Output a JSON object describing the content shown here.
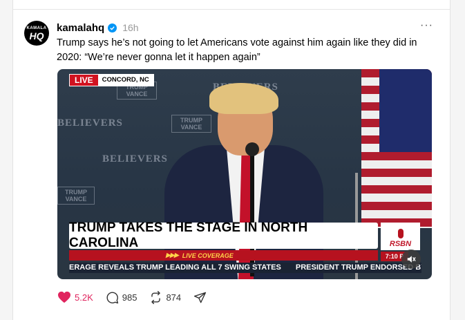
{
  "post": {
    "username": "kamalahq",
    "timestamp": "16h",
    "avatar_text_top": "KAMALA",
    "avatar_text_main": "HQ",
    "more_label": "···",
    "caption": "Trump says he’s not going to let Americans vote against him again like they did in 2020: “We’re never gonna let it happen again”"
  },
  "video": {
    "live_label": "LIVE",
    "location": "CONCORD, NC",
    "backdrop": {
      "believers_1": "BELIEVERS",
      "believers_2": "BELIEVERS",
      "believers_3": "BELIEVERS",
      "trump_vance_1": "TRUMP VANCE",
      "trump_vance_2": "TRUMP VANCE",
      "trump_vance_3": "TRUMP VANCE"
    },
    "chyron": "TRUMP TAKES THE STAGE IN NORTH CAROLINA",
    "live_coverage": "LIVE COVERAGE",
    "network": "RSBN",
    "clock": "7:10 P",
    "ticker": [
      "ERAGE REVEALS TRUMP LEADING ALL 7 SWING STATES",
      "PRESIDENT TRUMP ENDORSED BY OVER"
    ]
  },
  "actions": {
    "likes": "5.2K",
    "comments": "985",
    "reposts": "874"
  },
  "colors": {
    "like": "#e0245e",
    "verified": "#0095f6",
    "live_red": "#d1121f"
  },
  "icons": [
    "verified-badge-icon",
    "more-icon",
    "mute-icon",
    "heart-icon",
    "comment-icon",
    "repost-icon",
    "share-icon"
  ]
}
